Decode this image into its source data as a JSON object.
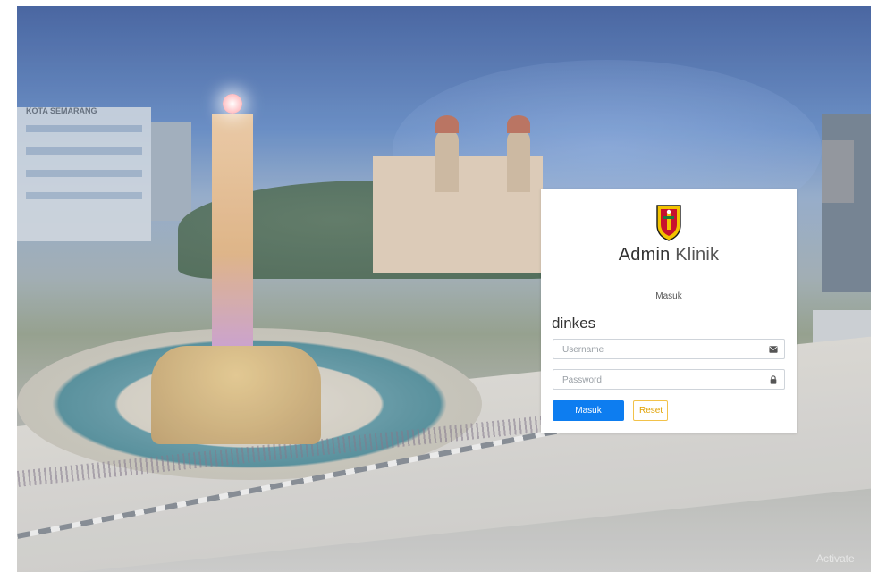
{
  "login": {
    "title_bold": "Admin",
    "title_light": "Klinik",
    "subtitle": "Masuk",
    "agency": "dinkes",
    "username_placeholder": "Username",
    "password_placeholder": "Password",
    "submit_label": "Masuk",
    "reset_label": "Reset"
  },
  "background": {
    "sign_text": "KOTA SEMARANG"
  },
  "watermark": "Activate",
  "icons": {
    "logo": "kota-semarang-crest-icon",
    "username": "envelope-icon",
    "password": "lock-icon"
  },
  "colors": {
    "primary": "#0d7df0",
    "warning": "#f2c24a"
  }
}
